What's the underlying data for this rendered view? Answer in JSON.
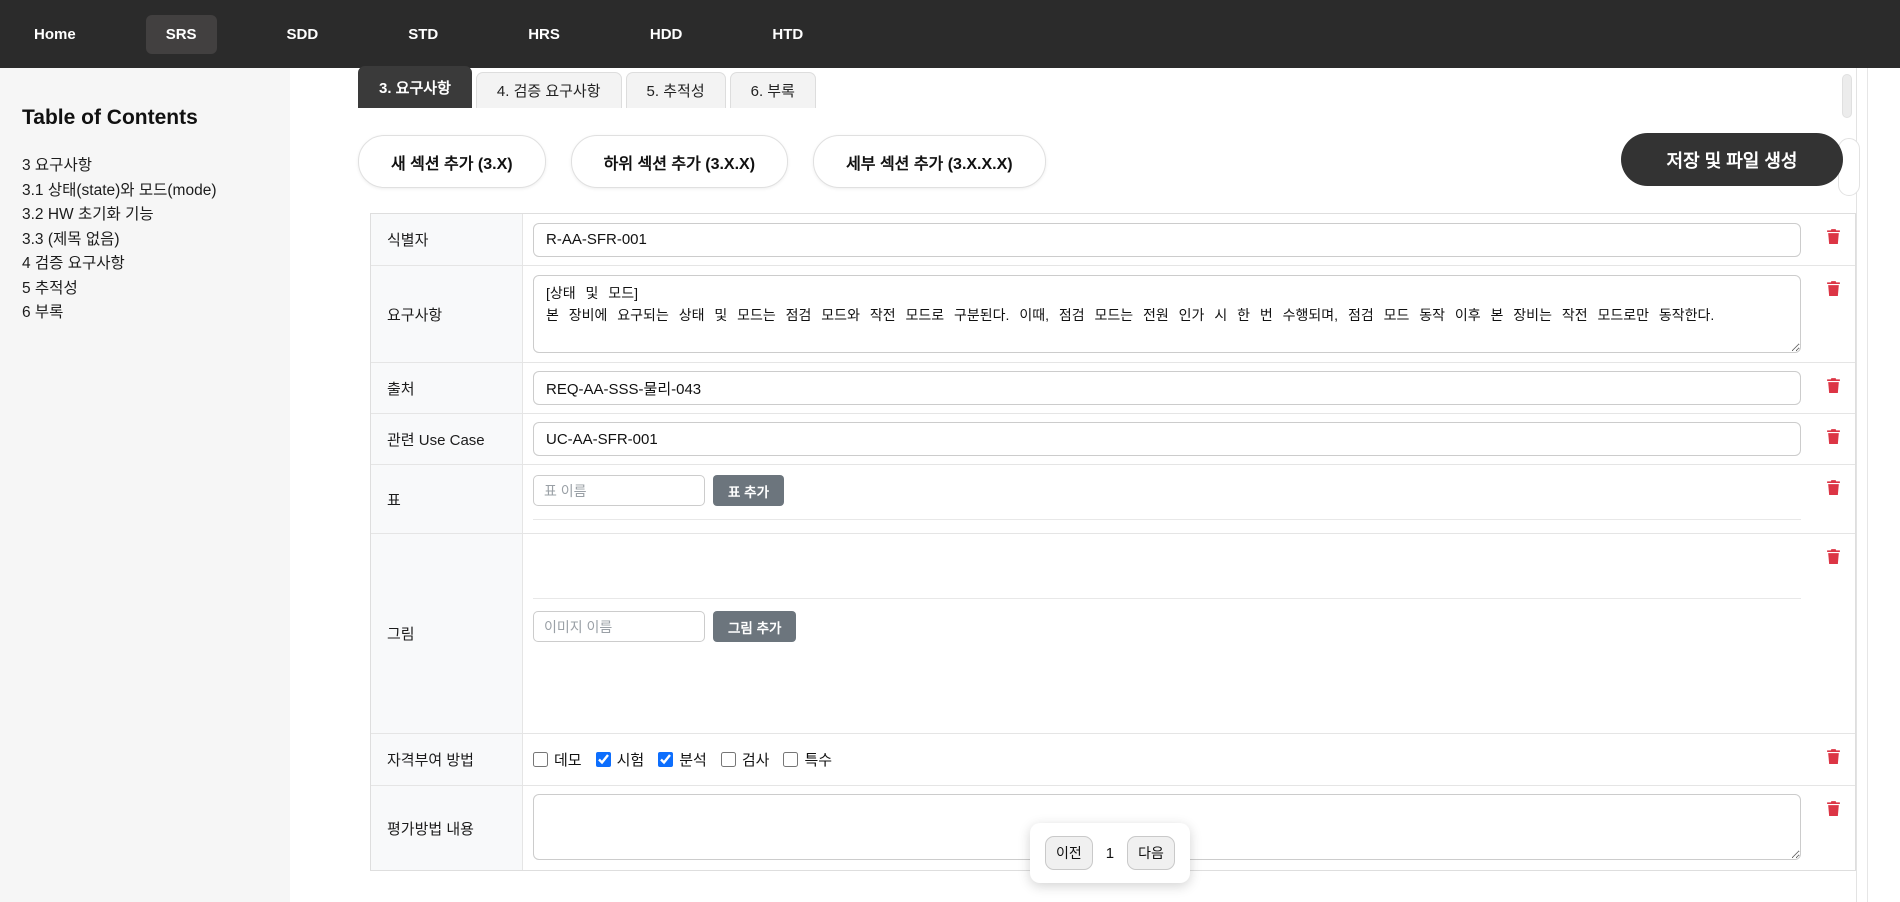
{
  "nav": {
    "items": [
      {
        "label": "Home",
        "active": false
      },
      {
        "label": "SRS",
        "active": true
      },
      {
        "label": "SDD",
        "active": false
      },
      {
        "label": "STD",
        "active": false
      },
      {
        "label": "HRS",
        "active": false
      },
      {
        "label": "HDD",
        "active": false
      },
      {
        "label": "HTD",
        "active": false
      }
    ]
  },
  "sidebar": {
    "title": "Table of Contents",
    "items": [
      {
        "label": "3 요구사항"
      },
      {
        "label": "3.1 상태(state)와 모드(mode)"
      },
      {
        "label": "3.2 HW 초기화 기능"
      },
      {
        "label": "3.3 (제목 없음)"
      },
      {
        "label": "4 검증 요구사항"
      },
      {
        "label": "5 추적성"
      },
      {
        "label": "6 부록"
      }
    ]
  },
  "tabs": [
    {
      "label": "3. 요구사항",
      "active": true
    },
    {
      "label": "4. 검증 요구사항",
      "active": false
    },
    {
      "label": "5. 추적성",
      "active": false
    },
    {
      "label": "6. 부록",
      "active": false
    }
  ],
  "toolbar": {
    "add_section_label": "새 섹션 추가 (3.X)",
    "add_sub_section_label": "하위 섹션 추가 (3.X.X)",
    "add_detail_section_label": "세부 섹션 추가 (3.X.X.X)",
    "save_label": "저장 및 파일 생성"
  },
  "form": {
    "identifier": {
      "label": "식별자",
      "value": "R-AA-SFR-001"
    },
    "requirement": {
      "label": "요구사항",
      "value": "[상태 및 모드]\n본 장비에 요구되는 상태 및 모드는 점검 모드와 작전 모드로 구분된다. 이때, 점검 모드는 전원 인가 시 한 번 수행되며, 점검 모드 동작 이후 본 장비는 작전 모드로만 동작한다."
    },
    "source": {
      "label": "출처",
      "value": "REQ-AA-SSS-물리-043"
    },
    "use_case": {
      "label": "관련 Use Case",
      "value": "UC-AA-SFR-001"
    },
    "table_row": {
      "label": "표",
      "placeholder": "표 이름",
      "button_label": "표 추가"
    },
    "figure_row": {
      "label": "그림",
      "placeholder": "이미지 이름",
      "button_label": "그림 추가"
    },
    "qualification": {
      "label": "자격부여 방법",
      "options": [
        {
          "label": "데모",
          "checked": false
        },
        {
          "label": "시험",
          "checked": true
        },
        {
          "label": "분석",
          "checked": true
        },
        {
          "label": "검사",
          "checked": false
        },
        {
          "label": "특수",
          "checked": false
        }
      ]
    },
    "evaluation": {
      "label": "평가방법 내용",
      "value": ""
    }
  },
  "pagination": {
    "prev_label": "이전",
    "page": "1",
    "next_label": "다음"
  },
  "colors": {
    "nav_bg": "#2b2b2b",
    "active_tab_bg": "#3a3a3a",
    "save_button_bg": "#333333",
    "add_button_bg": "#6c757d",
    "checkbox_accent": "#0d6efd",
    "trash_red": "#dc3545",
    "sidebar_bg": "#f6f6f6",
    "label_cell_bg": "#f8f9fa"
  }
}
